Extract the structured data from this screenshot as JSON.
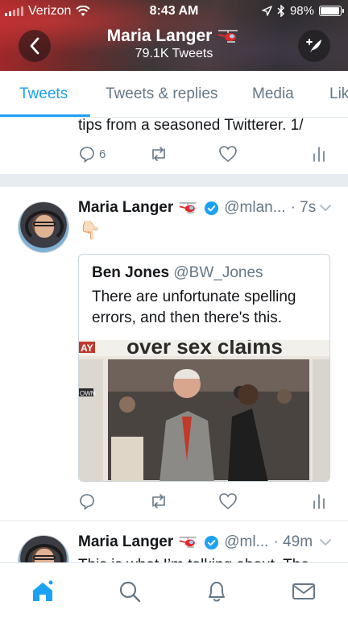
{
  "status_bar": {
    "carrier": "Verizon",
    "time": "8:43 AM",
    "battery": "98%",
    "battery_level": 0.98
  },
  "header": {
    "title": "Maria Langer",
    "subtitle": "79.1K Tweets",
    "icons": [
      "back-arrow-icon",
      "helicopter-icon",
      "compose-icon"
    ]
  },
  "tabs": [
    {
      "label": "Tweets",
      "active": true
    },
    {
      "label": "Tweets & replies",
      "active": false
    },
    {
      "label": "Media",
      "active": false
    },
    {
      "label": "Lik",
      "active": false
    }
  ],
  "tweets": [
    {
      "text_fragment": "tips from a seasoned Twitterer. 1/",
      "reply_count": "6"
    },
    {
      "name": "Maria Langer",
      "handle": "@mlan...",
      "time": "· 7s",
      "emoji": "👇🏻",
      "quote": {
        "name": "Ben Jones",
        "handle": "@BW_Jones",
        "text": "There are unfortunate spelling errors, and then there's this.",
        "image_headline": "over sex claims",
        "image_sidebar": "AY",
        "image_own": "OWN"
      }
    },
    {
      "name": "Maria Langer",
      "handle": "@ml...",
      "time": "· 49m",
      "text_fragment": "This is what I’m talking about. The"
    }
  ],
  "bottom_nav": [
    "home-icon",
    "search-icon",
    "notifications-icon",
    "messages-icon"
  ],
  "colors": {
    "accent": "#1da1f2",
    "secondary_text": "#657786",
    "verified": "#1da1f2"
  }
}
